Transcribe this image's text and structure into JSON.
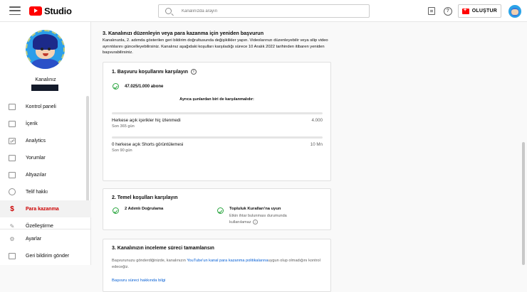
{
  "app": {
    "logo_text": "Studio"
  },
  "search": {
    "placeholder": "Kanalınızda arayın"
  },
  "header": {
    "create_label": "OLUŞTUR"
  },
  "channel": {
    "name": "Kanalınız"
  },
  "sidebar": {
    "items": [
      {
        "label": "Kontrol paneli",
        "icon": "dashboard-icon",
        "active": false
      },
      {
        "label": "İçerik",
        "icon": "content-icon",
        "active": false
      },
      {
        "label": "Analytics",
        "icon": "analytics-icon",
        "active": false
      },
      {
        "label": "Yorumlar",
        "icon": "comments-icon",
        "active": false
      },
      {
        "label": "Altyazılar",
        "icon": "subtitles-icon",
        "active": false
      },
      {
        "label": "Telif hakkı",
        "icon": "copyright-icon",
        "active": false
      },
      {
        "label": "Para kazanma",
        "icon": "dollar-icon",
        "active": true
      },
      {
        "label": "Özelleştirme",
        "icon": "customization-icon",
        "active": false
      }
    ],
    "bottom": [
      {
        "label": "Ayarlar",
        "icon": "gear-icon"
      },
      {
        "label": "Geri bildirim gönder",
        "icon": "feedback-icon"
      }
    ]
  },
  "main": {
    "section_title": "3. Kanalınızı düzenleyin veya para kazanma için yeniden başvurun",
    "section_desc": "Kanalınızda, 2. adımda gösterilen geri bildirim doğrultusunda değişiklikler yapın. Videolarınızı düzenleyebilir veya silip video ayrıntılarını güncelleyebilirsiniz. Kanalınız aşağıdaki koşulları karşıladığı sürece 10 Aralık 2022 tarihinden itibaren yeniden başvurabilirsiniz.",
    "card1": {
      "title": "1. Başvuru koşullarını karşılayın",
      "subscribers": "47.025/1.000 abone",
      "also_label": "Ayrıca şunlardan biri de karşılanmalıdır:",
      "metrics": [
        {
          "name": "Herkese açık içerikler hiç izlenmedi",
          "sub": "Son 365 gün",
          "value": "4.000",
          "progress": 0
        },
        {
          "name": "0 herkese açık Shorts görüntülemesi",
          "sub": "Son 90 gün",
          "value": "10 Mn",
          "progress": 0
        }
      ]
    },
    "card2": {
      "title": "2. Temel koşulları karşılayın",
      "items": [
        {
          "label": "2 Adımlı Doğrulama",
          "desc": ""
        },
        {
          "label": "Topluluk Kuralları'na uyun",
          "desc": "Etkin ihtar bulunması durumunda kullanılamaz"
        }
      ]
    },
    "card3": {
      "title": "3. Kanalınızın inceleme süreci tamamlansın",
      "desc_before": "Başvurunuzu gönderdiğinizde, kanalınızın ",
      "desc_link": "YouTube'un kanal para kazanma politikalarına",
      "desc_after": "uygun olup olmadığını kontrol edeceğiz.",
      "link": "Başvuru süreci hakkında bilgi"
    }
  }
}
